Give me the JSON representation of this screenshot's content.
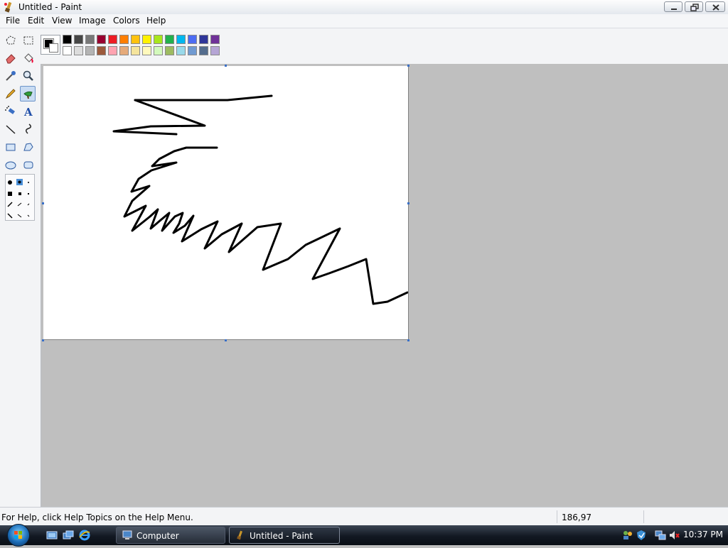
{
  "window": {
    "title": "Untitled - Paint"
  },
  "menu": {
    "items": [
      "File",
      "Edit",
      "View",
      "Image",
      "Colors",
      "Help"
    ]
  },
  "toolbox": {
    "tools": [
      {
        "name": "free-form-select-icon"
      },
      {
        "name": "select-icon"
      },
      {
        "name": "eraser-icon"
      },
      {
        "name": "fill-bucket-icon"
      },
      {
        "name": "pick-color-icon"
      },
      {
        "name": "magnifier-icon"
      },
      {
        "name": "pencil-icon"
      },
      {
        "name": "brush-icon",
        "selected": true
      },
      {
        "name": "airbrush-icon"
      },
      {
        "name": "text-icon",
        "glyph": "A"
      },
      {
        "name": "line-icon"
      },
      {
        "name": "curve-icon"
      },
      {
        "name": "rectangle-icon"
      },
      {
        "name": "polygon-icon"
      },
      {
        "name": "ellipse-icon"
      },
      {
        "name": "rounded-rectangle-icon"
      }
    ]
  },
  "palette": {
    "foreground": "#000000",
    "background": "#ffffff",
    "row1": [
      "#000000",
      "#464646",
      "#787878",
      "#990030",
      "#ed1c24",
      "#ff7e00",
      "#ffc20e",
      "#fff200",
      "#a8e61d",
      "#22b14c",
      "#00b7ef",
      "#4d6df3",
      "#2f3699",
      "#6f3198"
    ],
    "row2": [
      "#ffffff",
      "#dcdcdc",
      "#b4b4b4",
      "#9c5a3c",
      "#ffa3b1",
      "#e5aa7a",
      "#f5e49c",
      "#fff9bd",
      "#d3f9bc",
      "#9dbb61",
      "#99d9ea",
      "#709ad1",
      "#546d8e",
      "#b5a5d5"
    ]
  },
  "drawing": {
    "stroke_color": "#000000"
  },
  "status": {
    "help_text": "For Help, click Help Topics on the Help Menu.",
    "coordinates": "186,97"
  },
  "taskbar": {
    "buttons": [
      {
        "label": "Computer"
      },
      {
        "label": "Untitled - Paint",
        "active": true
      }
    ],
    "clock": "10:37 PM"
  }
}
